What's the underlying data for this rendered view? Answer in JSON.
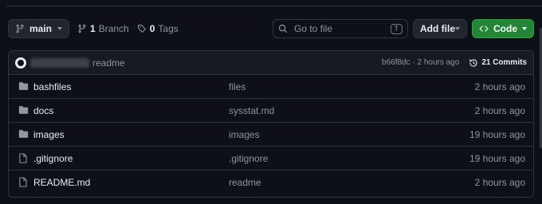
{
  "toolbar": {
    "branch_label": "main",
    "branch_count": "1",
    "branch_word": "Branch",
    "tag_count": "0",
    "tag_word": "Tags",
    "search_placeholder": "Go to file",
    "search_shortcut": "T",
    "add_file_label": "Add file",
    "code_label": "Code"
  },
  "commit": {
    "message": "readme",
    "hash_time": "b66f8dc · 2 hours ago",
    "commits_label": "21 Commits"
  },
  "files": [
    {
      "type": "folder",
      "name": "bashfiles",
      "message": "files",
      "time": "2 hours ago"
    },
    {
      "type": "folder",
      "name": "docs",
      "message": "sysstat.md",
      "time": "2 hours ago"
    },
    {
      "type": "folder",
      "name": "images",
      "message": "images",
      "time": "19 hours ago"
    },
    {
      "type": "file",
      "name": ".gitignore",
      "message": ".gitignore",
      "time": "19 hours ago"
    },
    {
      "type": "file",
      "name": "README.md",
      "message": "readme",
      "time": "2 hours ago"
    }
  ],
  "colors": {
    "background": "#0d1117",
    "border": "#30363d",
    "code_button": "#238636",
    "muted_text": "#8b949e"
  }
}
